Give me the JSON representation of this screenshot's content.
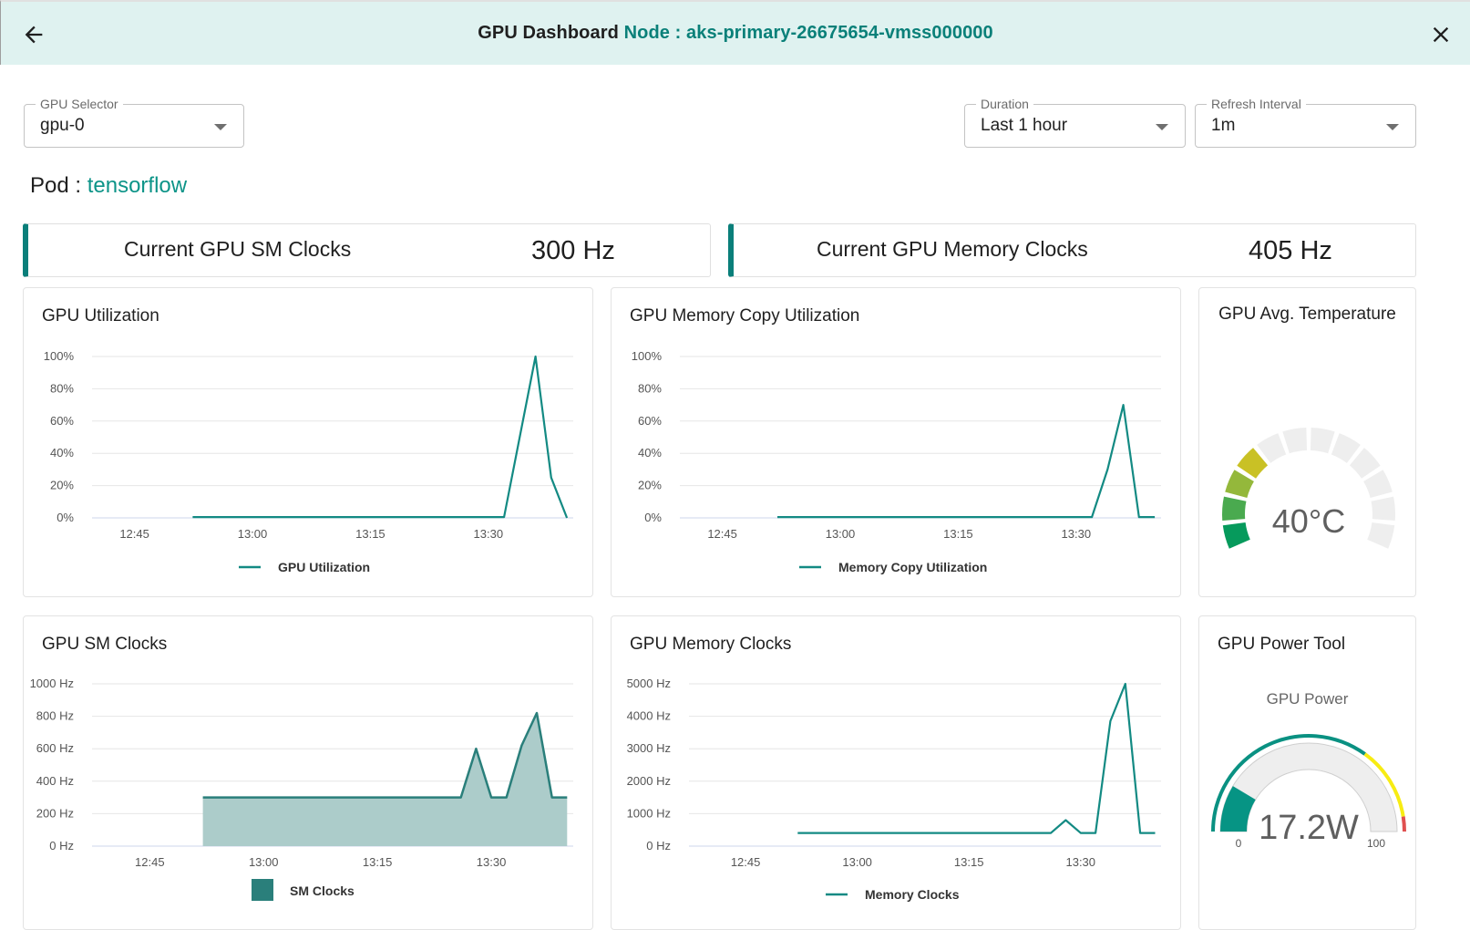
{
  "header": {
    "title": "GPU Dashboard",
    "node_label": "Node : aks-primary-26675654-vmss000000",
    "back_icon": "arrow-left-icon",
    "close_icon": "close-icon"
  },
  "controls": {
    "gpu_selector": {
      "label": "GPU Selector",
      "value": "gpu-0"
    },
    "duration": {
      "label": "Duration",
      "value": "Last 1 hour"
    },
    "refresh_interval": {
      "label": "Refresh Interval",
      "value": "1m"
    }
  },
  "pod": {
    "label": "Pod :",
    "value": "tensorflow"
  },
  "stats": [
    {
      "label": "Current GPU SM Clocks",
      "value": "300 Hz"
    },
    {
      "label": "Current GPU Memory Clocks",
      "value": "405 Hz"
    }
  ],
  "colors": {
    "accent": "#0a8079",
    "line": "#138a83",
    "area_fill": "#acccca",
    "area_line": "#2a7f7b",
    "header_bg": "#dff2f0"
  },
  "chart_data": [
    {
      "id": "gpu-utilization",
      "type": "line",
      "title": "GPU Utilization",
      "xlabel": "",
      "ylabel": "",
      "x_unit": "minutes since 12:00",
      "xlim": [
        39.6,
        40.8
      ],
      "xticks": [
        {
          "v": 45,
          "label": "12:45"
        },
        {
          "v": 60,
          "label": "13:00"
        },
        {
          "v": 75,
          "label": "13:15"
        },
        {
          "v": 90,
          "label": "13:30"
        }
      ],
      "ylim": [
        0,
        100
      ],
      "yticks": [
        {
          "v": 0,
          "label": "0%"
        },
        {
          "v": 20,
          "label": "20%"
        },
        {
          "v": 40,
          "label": "40%"
        },
        {
          "v": 60,
          "label": "60%"
        },
        {
          "v": 80,
          "label": "80%"
        },
        {
          "v": 100,
          "label": "100%"
        }
      ],
      "grid": true,
      "legend": "bottom-center",
      "series": [
        {
          "name": "GPU Utilization",
          "style": "line",
          "points": [
            [
              52.4,
              0.5
            ],
            [
              92,
              0.5
            ],
            [
              96,
              100
            ],
            [
              98,
              25
            ],
            [
              100,
              0
            ]
          ]
        }
      ]
    },
    {
      "id": "gpu-memory-copy-utilization",
      "type": "line",
      "title": "GPU Memory Copy Utilization",
      "xlabel": "",
      "ylabel": "",
      "x_unit": "minutes since 12:00",
      "xlim": [
        39.6,
        40.8
      ],
      "xticks": [
        {
          "v": 45,
          "label": "12:45"
        },
        {
          "v": 60,
          "label": "13:00"
        },
        {
          "v": 75,
          "label": "13:15"
        },
        {
          "v": 90,
          "label": "13:30"
        }
      ],
      "ylim": [
        0,
        100
      ],
      "yticks": [
        {
          "v": 0,
          "label": "0%"
        },
        {
          "v": 20,
          "label": "20%"
        },
        {
          "v": 40,
          "label": "40%"
        },
        {
          "v": 60,
          "label": "60%"
        },
        {
          "v": 80,
          "label": "80%"
        },
        {
          "v": 100,
          "label": "100%"
        }
      ],
      "grid": true,
      "legend": "bottom-center",
      "series": [
        {
          "name": "Memory Copy Utilization",
          "style": "line",
          "points": [
            [
              52,
              0.5
            ],
            [
              92,
              0.5
            ],
            [
              94,
              30
            ],
            [
              96,
              70
            ],
            [
              98,
              0.5
            ],
            [
              100,
              0.5
            ]
          ]
        }
      ]
    },
    {
      "id": "gpu-sm-clocks",
      "type": "area",
      "title": "GPU SM Clocks",
      "xlabel": "",
      "ylabel": "",
      "x_unit": "minutes since 12:00",
      "xlim": [
        37.4,
        40.8
      ],
      "xticks": [
        {
          "v": 45,
          "label": "12:45"
        },
        {
          "v": 60,
          "label": "13:00"
        },
        {
          "v": 75,
          "label": "13:15"
        },
        {
          "v": 90,
          "label": "13:30"
        }
      ],
      "ylim": [
        0,
        1000
      ],
      "yticks": [
        {
          "v": 0,
          "label": "0 Hz"
        },
        {
          "v": 200,
          "label": "200 Hz"
        },
        {
          "v": 400,
          "label": "400 Hz"
        },
        {
          "v": 600,
          "label": "600 Hz"
        },
        {
          "v": 800,
          "label": "800 Hz"
        },
        {
          "v": 1000,
          "label": "1000 Hz"
        }
      ],
      "grid": true,
      "legend": "bottom-center",
      "series": [
        {
          "name": "SM Clocks",
          "style": "area",
          "points": [
            [
              52,
              300
            ],
            [
              86,
              300
            ],
            [
              88,
              600
            ],
            [
              90,
              300
            ],
            [
              92,
              300
            ],
            [
              94,
              620
            ],
            [
              96,
              820
            ],
            [
              98,
              300
            ],
            [
              100,
              300
            ]
          ]
        }
      ]
    },
    {
      "id": "gpu-memory-clocks",
      "type": "line",
      "title": "GPU Memory Clocks",
      "xlabel": "",
      "ylabel": "",
      "x_unit": "minutes since 12:00",
      "xlim": [
        37.4,
        40.8
      ],
      "xticks": [
        {
          "v": 45,
          "label": "12:45"
        },
        {
          "v": 60,
          "label": "13:00"
        },
        {
          "v": 75,
          "label": "13:15"
        },
        {
          "v": 90,
          "label": "13:30"
        }
      ],
      "ylim": [
        0,
        5000
      ],
      "yticks": [
        {
          "v": 0,
          "label": "0 Hz"
        },
        {
          "v": 1000,
          "label": "1000 Hz"
        },
        {
          "v": 2000,
          "label": "2000 Hz"
        },
        {
          "v": 3000,
          "label": "3000 Hz"
        },
        {
          "v": 4000,
          "label": "4000 Hz"
        },
        {
          "v": 5000,
          "label": "5000 Hz"
        }
      ],
      "grid": true,
      "legend": "bottom-center",
      "series": [
        {
          "name": "Memory Clocks",
          "style": "line",
          "points": [
            [
              52,
              405
            ],
            [
              86,
              405
            ],
            [
              88,
              800
            ],
            [
              90,
              405
            ],
            [
              92,
              405
            ],
            [
              94,
              3850
            ],
            [
              96,
              5000
            ],
            [
              98,
              405
            ],
            [
              100,
              405
            ]
          ]
        }
      ]
    }
  ],
  "temperature_gauge": {
    "title": "GPU Avg. Temperature",
    "value_label": "40°C",
    "segments_total": 12,
    "segments_filled": 4,
    "segment_colors": [
      "#069a5c",
      "#4aaa4f",
      "#94b83b",
      "#c9c125"
    ],
    "empty_color": "#eeeeee"
  },
  "power_gauge": {
    "title": "GPU Power Tool",
    "subtitle": "GPU Power",
    "value": 17.2,
    "value_label": "17.2W",
    "min": 0,
    "max": 100,
    "min_label": "0",
    "max_label": "100",
    "bands": [
      {
        "from": 0,
        "to": 70,
        "color": "#0a9182"
      },
      {
        "from": 70,
        "to": 95,
        "color": "#f7ec13"
      },
      {
        "from": 95,
        "to": 100,
        "color": "#e05050"
      }
    ],
    "fill_color": "#069484",
    "track_color": "#eeeeee"
  }
}
